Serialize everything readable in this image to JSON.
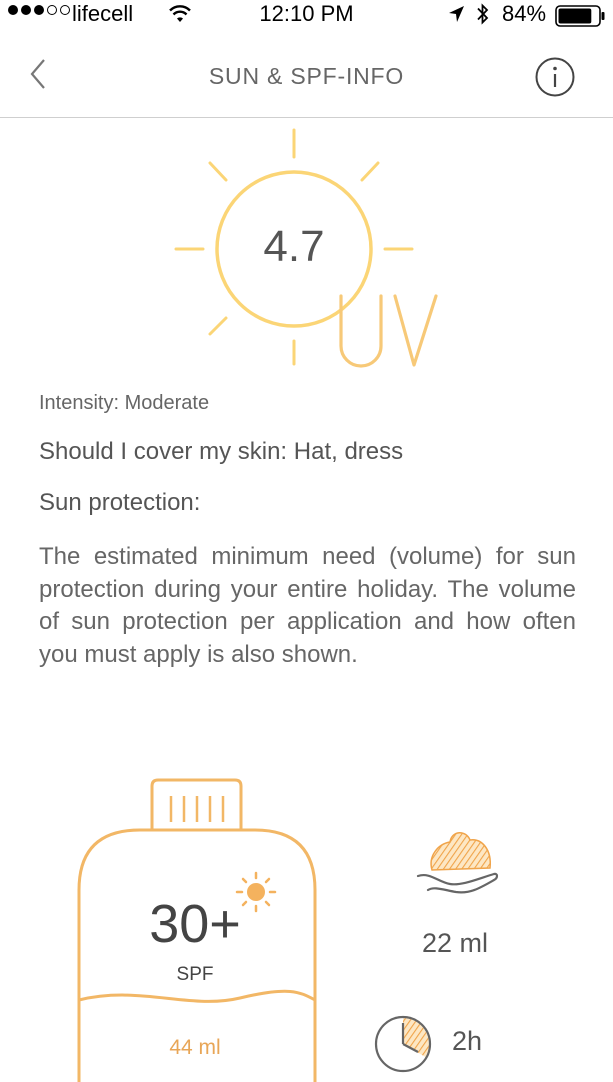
{
  "status_bar": {
    "carrier": "lifecell",
    "time": "12:10 PM",
    "battery": "84%",
    "battery_level": 0.84
  },
  "nav": {
    "title": "SUN & SPF-INFO",
    "back_icon": "chevron-left-icon",
    "info_icon": "info-circle-icon"
  },
  "uv": {
    "value": "4.7",
    "label": "UV"
  },
  "intensity": "Intensity: Moderate",
  "cover": "Should I cover my skin: Hat, dress",
  "protection_title": "Sun protection:",
  "description": "The estimated minimum need (volume) for sun protection during your entire holiday. The volume of sun protection per application and how often you must apply is also shown.",
  "bottle": {
    "spf": "30+",
    "spf_label": "SPF",
    "volume": "44 ml"
  },
  "per_application": "22 ml",
  "interval": "2h",
  "colors": {
    "sun_yellow": "#fbd576",
    "accent_orange": "#f2b766",
    "icon_gray": "#666666"
  }
}
